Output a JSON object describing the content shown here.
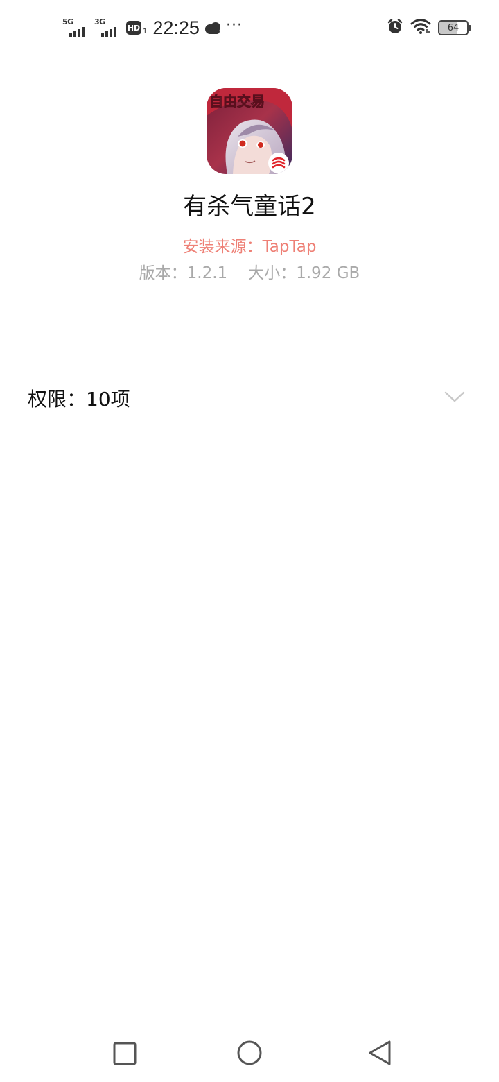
{
  "status_bar": {
    "network1": "5G",
    "network2": "3G",
    "hd_badge": "HD",
    "hd_sub": "1",
    "time": "22:25",
    "battery": "64",
    "battery_level": 0.64,
    "icons": [
      "cloud-icon",
      "more-icon",
      "alarm-icon",
      "wifi-icon",
      "battery-icon"
    ]
  },
  "app": {
    "icon_name": "app-icon",
    "icon_text": "自由交易",
    "name": "有杀气童话2",
    "install_source": "安装来源：TapTap",
    "version": "版本：1.2.1",
    "size": "大小：1.92 GB"
  },
  "permissions": {
    "label": "权限：10项",
    "expand_icon": "chevron-down-icon"
  },
  "nav": {
    "icons": [
      "recents-icon",
      "home-icon",
      "back-icon"
    ]
  },
  "colors": {
    "install_source": "#ee8076",
    "meta": "#a9a9a9",
    "chevron": "#c8c8c8",
    "nav": "#555555"
  }
}
